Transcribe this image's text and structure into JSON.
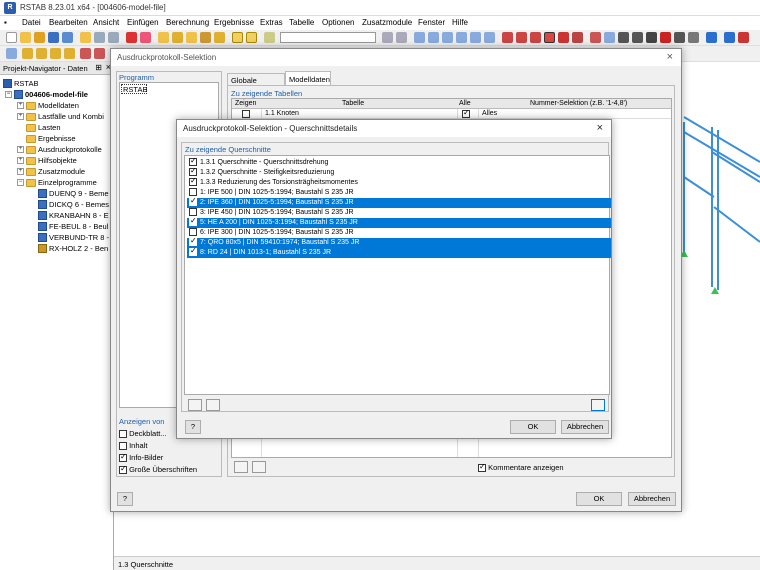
{
  "window": {
    "title": "RSTAB 8.23.01 x64 - [004606-model-file]",
    "app_icon": "rstab-app-icon"
  },
  "menu": [
    "Datei",
    "Bearbeiten",
    "Ansicht",
    "Einfügen",
    "Berechnung",
    "Ergebnisse",
    "Extras",
    "Tabelle",
    "Optionen",
    "Zusatzmodule",
    "Fenster",
    "Hilfe"
  ],
  "navigator": {
    "header": "Projekt-Navigator - Daten",
    "root": "RSTAB",
    "model": "004606-model-file",
    "items": [
      "Modelldaten",
      "Lastfälle und Kombi",
      "Lasten",
      "Ergebnisse",
      "Ausdruckprotokolle",
      "Hilfsobjekte",
      "Zusatzmodule",
      "Einzelprogramme"
    ],
    "programs": [
      "DUENQ 9 - Beme",
      "DICKQ 6 - Bemes",
      "KRANBAHN 8 - E",
      "FE-BEUL 8 - Beul",
      "VERBUND-TR 8 -",
      "RX-HOLZ 2 - Ben"
    ]
  },
  "status": {
    "text": "1.3 Querschnitte"
  },
  "main_dialog": {
    "title": "Ausdruckprotokoll-Selektion",
    "program_label": "Programm",
    "program_item": "RSTAB",
    "tabs": [
      "Globale Selektion",
      "Modelldaten"
    ],
    "tables_label": "Zu zeigende Tabellen",
    "columns": [
      "Zeigen",
      "Tabelle",
      "Alle",
      "Nummer-Selektion (z.B. '1-4,8')"
    ],
    "first_row": {
      "table": "1.1 Knoten",
      "selection": "Alles"
    },
    "show_label": "Anzeigen von",
    "show_options": [
      {
        "label": "Deckblatt...",
        "checked": false
      },
      {
        "label": "Inhalt",
        "checked": false
      },
      {
        "label": "Info-Bilder",
        "checked": true
      },
      {
        "label": "Große Überschriften",
        "checked": true
      }
    ],
    "comments_label": "Kommentare anzeigen",
    "ok": "OK",
    "cancel": "Abbrechen"
  },
  "sub_dialog": {
    "title": "Ausdruckprotokoll-Selektion - Querschnittsdetails",
    "list_label": "Zu zeigende Querschnitte",
    "rows": [
      {
        "label": "1.3.1 Querschnitte - Querschnittsdrehung",
        "checked": true,
        "selected": false
      },
      {
        "label": "1.3.2 Querschnitte - Steifigkeitsreduzierung",
        "checked": true,
        "selected": false
      },
      {
        "label": "1.3.3 Reduzierung des Torsionsträgheitsmomentes",
        "checked": true,
        "selected": false
      },
      {
        "label": "1: IPE 500 | DIN 1025-5:1994; Baustahl S 235 JR",
        "checked": false,
        "selected": false
      },
      {
        "label": "2: IPE 360 | DIN 1025-5:1994; Baustahl S 235 JR",
        "checked": true,
        "selected": true
      },
      {
        "label": "3: IPE 450 | DIN 1025-5:1994; Baustahl S 235 JR",
        "checked": false,
        "selected": false
      },
      {
        "label": "5: HE A 200 | DIN 1025-3:1994; Baustahl S 235 JR",
        "checked": true,
        "selected": true
      },
      {
        "label": "6: IPE 300 | DIN 1025-5:1994; Baustahl S 235 JR",
        "checked": false,
        "selected": false
      },
      {
        "label": "7: QRO 80x5 | DIN 59410:1974; Baustahl S 235 JR",
        "checked": true,
        "selected": true
      },
      {
        "label": "8: RD 24 | DIN 1013-1; Baustahl S 235 JR",
        "checked": true,
        "selected": true
      }
    ],
    "ok": "OK",
    "cancel": "Abbrechen"
  },
  "colors": {
    "selection": "#0078d7",
    "group_label": "#1f5fa8",
    "structure": "#3a8fd8",
    "support": "#3cbf5a"
  }
}
